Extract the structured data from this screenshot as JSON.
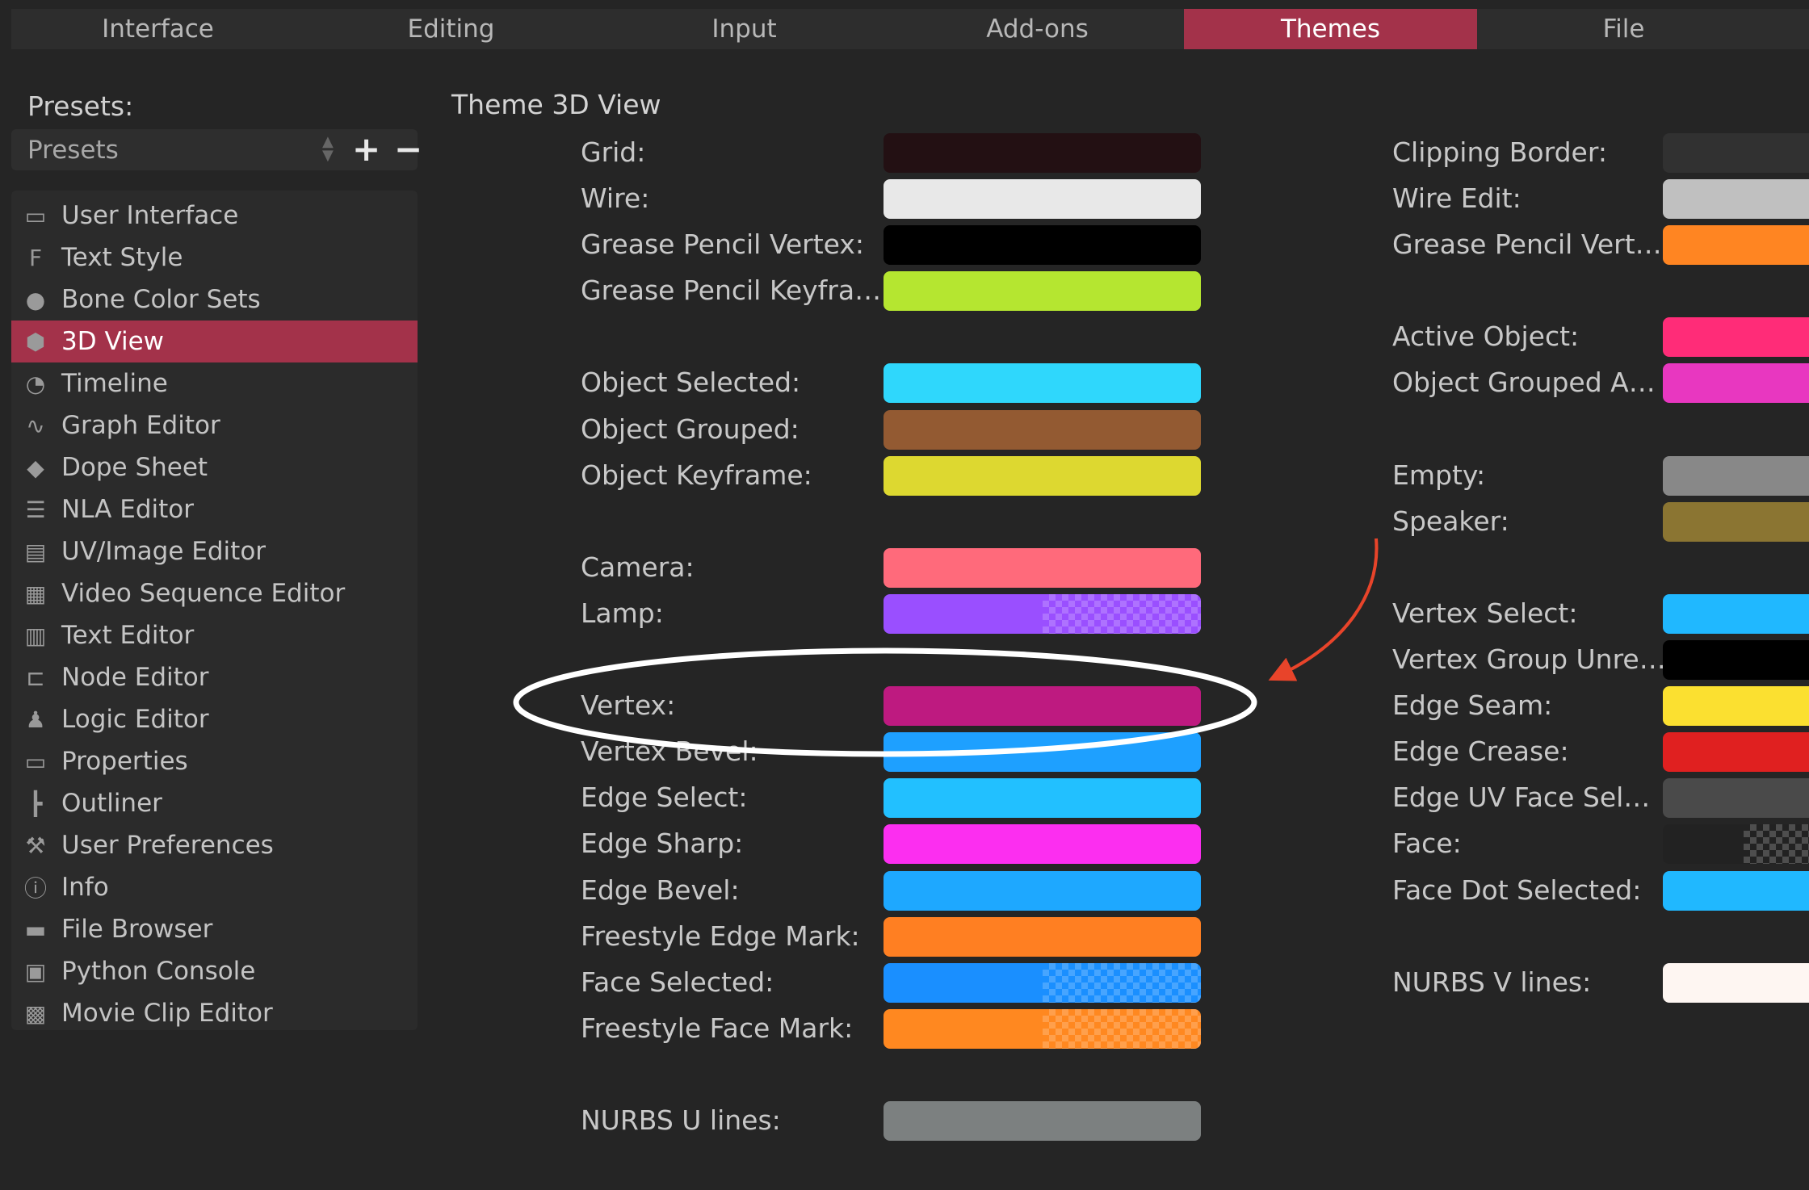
{
  "tabs": [
    {
      "label": "Interface"
    },
    {
      "label": "Editing"
    },
    {
      "label": "Input"
    },
    {
      "label": "Add-ons"
    },
    {
      "label": "Themes",
      "active": true
    },
    {
      "label": "File"
    }
  ],
  "presets": {
    "label": "Presets:",
    "value": "Presets",
    "add": "+",
    "remove": "−"
  },
  "sidebar": {
    "items": [
      {
        "label": "User Interface",
        "icon": "ui-icon",
        "glyph": "▭"
      },
      {
        "label": "Text Style",
        "icon": "text-style-icon",
        "glyph": "F"
      },
      {
        "label": "Bone Color Sets",
        "icon": "color-wheel-icon",
        "glyph": "●"
      },
      {
        "label": "3D View",
        "icon": "cube-icon",
        "glyph": "⬢",
        "active": true
      },
      {
        "label": "Timeline",
        "icon": "clock-icon",
        "glyph": "◔"
      },
      {
        "label": "Graph Editor",
        "icon": "curve-icon",
        "glyph": "∿"
      },
      {
        "label": "Dope Sheet",
        "icon": "keyframe-icon",
        "glyph": "◆"
      },
      {
        "label": "NLA Editor",
        "icon": "nla-icon",
        "glyph": "☰"
      },
      {
        "label": "UV/Image Editor",
        "icon": "image-icon",
        "glyph": "▤"
      },
      {
        "label": "Video Sequence Editor",
        "icon": "film-icon",
        "glyph": "▦"
      },
      {
        "label": "Text Editor",
        "icon": "document-icon",
        "glyph": "▥"
      },
      {
        "label": "Node Editor",
        "icon": "node-icon",
        "glyph": "⊏"
      },
      {
        "label": "Logic Editor",
        "icon": "joystick-icon",
        "glyph": "♟"
      },
      {
        "label": "Properties",
        "icon": "properties-icon",
        "glyph": "▭"
      },
      {
        "label": "Outliner",
        "icon": "outliner-icon",
        "glyph": "┣"
      },
      {
        "label": "User Preferences",
        "icon": "preferences-icon",
        "glyph": "⚒"
      },
      {
        "label": "Info",
        "icon": "info-icon",
        "glyph": "ⓘ"
      },
      {
        "label": "File Browser",
        "icon": "folder-icon",
        "glyph": "▬"
      },
      {
        "label": "Python Console",
        "icon": "console-icon",
        "glyph": "▣"
      },
      {
        "label": "Movie Clip Editor",
        "icon": "clapper-icon",
        "glyph": "▩"
      }
    ]
  },
  "main": {
    "title": "Theme 3D View",
    "left": [
      [
        {
          "label": "Grid:",
          "color": "#231013"
        },
        {
          "label": "Wire:",
          "color": "#e8e8e8"
        },
        {
          "label": "Grease Pencil Vertex:",
          "color": "#000000"
        },
        {
          "label": "Grease Pencil Keyfra…",
          "color": "#b5e630"
        }
      ],
      [
        {
          "label": "Object Selected:",
          "color": "#2fd7fc"
        },
        {
          "label": "Object Grouped:",
          "color": "#935a32"
        },
        {
          "label": "Object Keyframe:",
          "color": "#ddd830"
        }
      ],
      [
        {
          "label": "Camera:",
          "color": "#ff6a7b"
        },
        {
          "label": "Lamp:",
          "color": "#9a4fff",
          "alpha": true
        }
      ],
      [
        {
          "label": "Vertex:",
          "color": "#be1a80"
        },
        {
          "label": "Vertex Bevel:",
          "color": "#1ea0ff"
        },
        {
          "label": "Edge Select:",
          "color": "#22c0ff"
        },
        {
          "label": "Edge Sharp:",
          "color": "#fc2ef0"
        },
        {
          "label": "Edge Bevel:",
          "color": "#1ea8ff"
        },
        {
          "label": "Freestyle Edge Mark:",
          "color": "#ff7f22"
        },
        {
          "label": "Face Selected:",
          "color": "#1a8fff",
          "alpha": true
        },
        {
          "label": "Freestyle Face Mark:",
          "color": "#ff8820",
          "alpha": true
        }
      ],
      [
        {
          "label": "NURBS U lines:",
          "color": "#7c8080"
        }
      ]
    ],
    "right": [
      [
        {
          "label": "Clipping Border:",
          "color": "#313131"
        },
        {
          "label": "Wire Edit:",
          "color": "#c0c0c0"
        },
        {
          "label": "Grease Pencil Vert…",
          "color": "#ff8522"
        }
      ],
      [
        {
          "label": "Active Object:",
          "color": "#ff2c78"
        },
        {
          "label": "Object Grouped A…",
          "color": "#e837c0"
        }
      ],
      [
        {
          "label": "Empty:",
          "color": "#888888"
        },
        {
          "label": "Speaker:",
          "color": "#8b7532"
        }
      ],
      [
        {
          "label": "Vertex Select:",
          "color": "#20b8ff"
        },
        {
          "label": "Vertex Group Unre…",
          "color": "#000000"
        },
        {
          "label": "Edge Seam:",
          "color": "#fbe030"
        },
        {
          "label": "Edge Crease:",
          "color": "#e02020"
        },
        {
          "label": "Edge UV Face Sel…",
          "color": "#4a4a4a"
        },
        {
          "label": "Face:",
          "color": "#222222",
          "alpha": true
        },
        {
          "label": "Face Dot Selected:",
          "color": "#20b8ff"
        }
      ],
      [
        {
          "label": "NURBS V lines:",
          "color": "#fef6f2"
        }
      ]
    ]
  },
  "annotation": {
    "ellipse_color": "#ffffff",
    "arrow_color": "#e8442a"
  }
}
